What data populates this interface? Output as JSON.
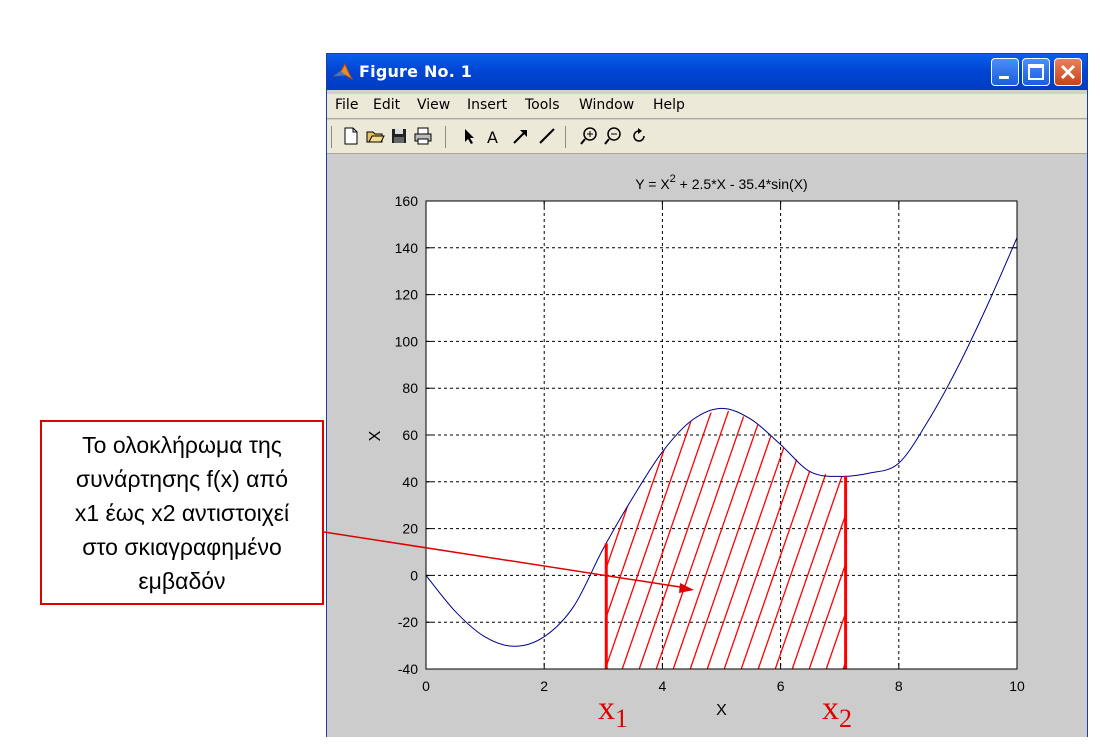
{
  "window": {
    "title": "Figure No. 1",
    "menu": [
      "File",
      "Edit",
      "View",
      "Insert",
      "Tools",
      "Window",
      "Help"
    ]
  },
  "toolbar": {
    "icons": [
      "new-file-icon",
      "open-folder-icon",
      "save-icon",
      "print-icon",
      "select-arrow-icon",
      "text-tool-icon",
      "arrow-tool-icon",
      "line-tool-icon",
      "zoom-in-icon",
      "zoom-out-icon",
      "rotate-icon"
    ],
    "text_tool_glyph": "A"
  },
  "annotation": {
    "lines": [
      "Το ολοκλήρωμα της",
      "συνάρτησης f(x) από",
      "x1 έως x2 αντιστοιχεί",
      "στο σκιαγραφημένο",
      "εμβαδόν"
    ],
    "x1_label": "x",
    "x1_sub": "1",
    "x2_label": "x",
    "x2_sub": "2",
    "color": "#e00000"
  },
  "chart_data": {
    "type": "line",
    "title_main": "Y = X",
    "title_sup": "2",
    "title_rest": " + 2.5*X - 35.4*sin(X)",
    "xlabel": "X",
    "ylabel": "X",
    "xlim": [
      0,
      10
    ],
    "ylim": [
      -40,
      160
    ],
    "xticks": [
      0,
      2,
      4,
      6,
      8,
      10
    ],
    "yticks": [
      -40,
      -20,
      0,
      20,
      40,
      60,
      80,
      100,
      120,
      140,
      160
    ],
    "grid": true,
    "series": [
      {
        "x": [
          0,
          0.5,
          1,
          1.5,
          2,
          2.5,
          3,
          3.5,
          4,
          4.5,
          5,
          5.5,
          6,
          6.5,
          7,
          7.5,
          8,
          8.5,
          9,
          9.5,
          10
        ],
        "y": [
          0,
          -15.5,
          -26.3,
          -30.3,
          -26.2,
          -13.2,
          11.5,
          33.3,
          52.8,
          66.3,
          71.4,
          66.7,
          55.9,
          44.3,
          42.3,
          43.7,
          48.0,
          66.2,
          89.1,
          115.5,
          144.3
        ],
        "color": "#00008b"
      }
    ],
    "shaded_region": {
      "x_from": 3.05,
      "x_to": 7.1,
      "color": "#ff0000",
      "style": "hatched"
    }
  }
}
